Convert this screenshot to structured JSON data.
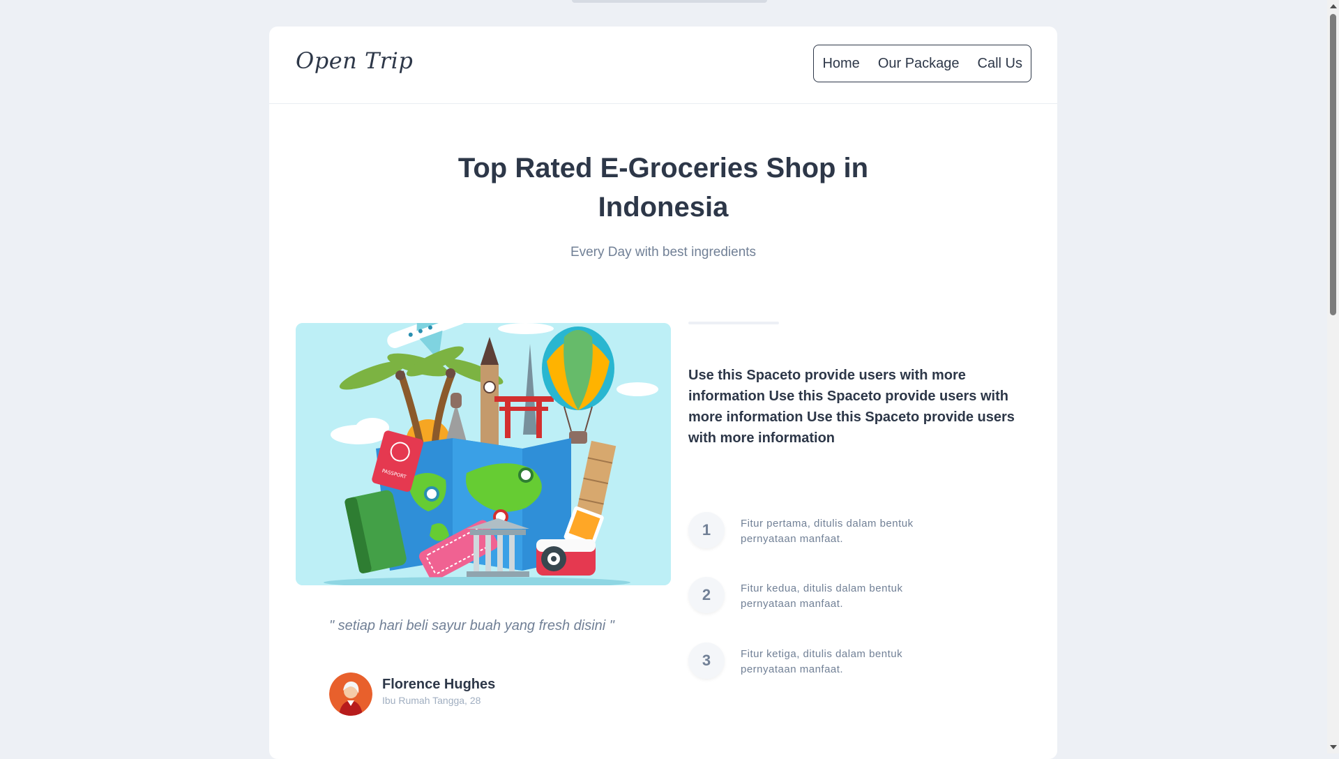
{
  "brand": "Open Trip",
  "nav": {
    "home": "Home",
    "package": "Our Package",
    "contact": "Call Us"
  },
  "hero": {
    "title_line1": "Top Rated E-Groceries Shop in",
    "title_line2": "Indonesia",
    "subtitle": "Every Day with best ingredients"
  },
  "testimonial": {
    "quote": "\" setiap hari beli sayur buah yang fresh disini \"",
    "name": "Florence Hughes",
    "role": "Ibu Rumah Tangga, 28"
  },
  "info": {
    "text": "Use this Spaceto provide users with more information Use this Spaceto provide users with more information Use this Spaceto provide users with more information"
  },
  "features": [
    {
      "num": "1",
      "text": "Fitur pertama, ditulis dalam bentuk pernyataan manfaat."
    },
    {
      "num": "2",
      "text": "Fitur kedua, ditulis dalam bentuk pernyataan manfaat."
    },
    {
      "num": "3",
      "text": "Fitur ketiga, ditulis dalam bentuk pernyataan manfaat."
    }
  ],
  "colors": {
    "background": "#edf0f5",
    "text": "#2d3748",
    "muted": "#718096",
    "illustration_bg": "#bdeff6"
  },
  "illustration": {
    "passport_label": "PASSPORT"
  }
}
